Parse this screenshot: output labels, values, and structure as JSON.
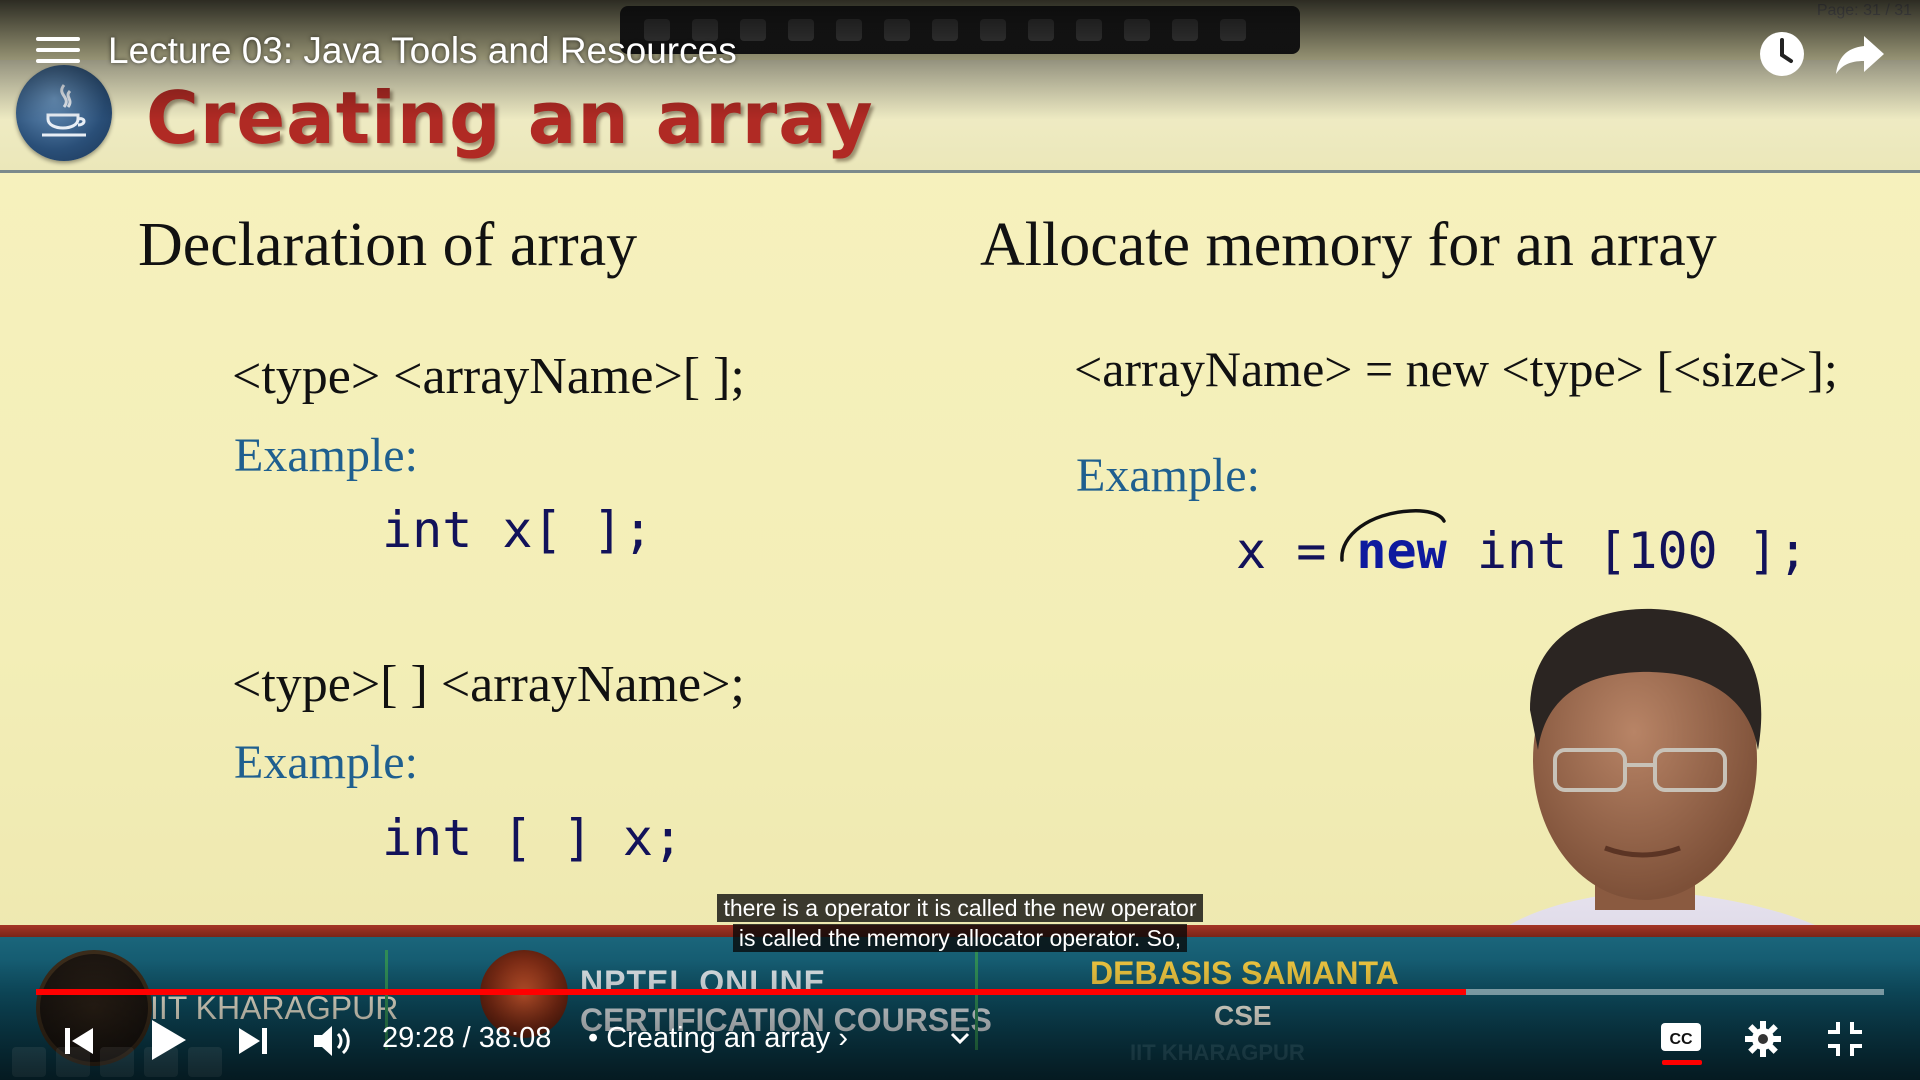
{
  "player": {
    "video_title": "Lecture 03: Java Tools and Resources",
    "current_time": "29:28",
    "duration": "38:08",
    "time_separator": " / ",
    "chapter_label": "• Creating an array ›",
    "progress_fraction": 0.774,
    "accent_color": "#ff0000",
    "icons": [
      "menu-icon",
      "watch-later-icon",
      "share-icon",
      "skip-previous-icon",
      "play-icon",
      "skip-next-icon",
      "volume-icon",
      "chevron-down-icon",
      "closed-captions-icon",
      "settings-icon",
      "exit-fullscreen-icon"
    ]
  },
  "captions": {
    "line1": "there is a operator it is called the new operator",
    "line2": "is called the memory allocator operator. So,"
  },
  "slide": {
    "page_counter": "Page: 31 / 31",
    "title": "Creating an array",
    "left": {
      "heading": "Declaration of array",
      "syntax1": "<type> <arrayName>[ ];",
      "example1_label": "Example:",
      "example1_code": "int x[ ];",
      "syntax2": "<type>[ ] <arrayName>;",
      "example2_label": "Example:",
      "example2_code": "int [ ] x;"
    },
    "right": {
      "heading": "Allocate memory for an array",
      "syntax": "<arrayName> = new <type> [<size>];",
      "example_label": "Example:",
      "code_pre": "x = ",
      "code_keyword": "new",
      "code_post": " int [100 ];"
    }
  },
  "banner": {
    "institute": "IIT KHARAGPUR",
    "program_line1": "NPTEL ONLINE",
    "program_line2": "CERTIFICATION COURSES",
    "speaker": "DEBASIS SAMANTA",
    "department": "CSE",
    "institute_faint": "IIT KHARAGPUR"
  }
}
